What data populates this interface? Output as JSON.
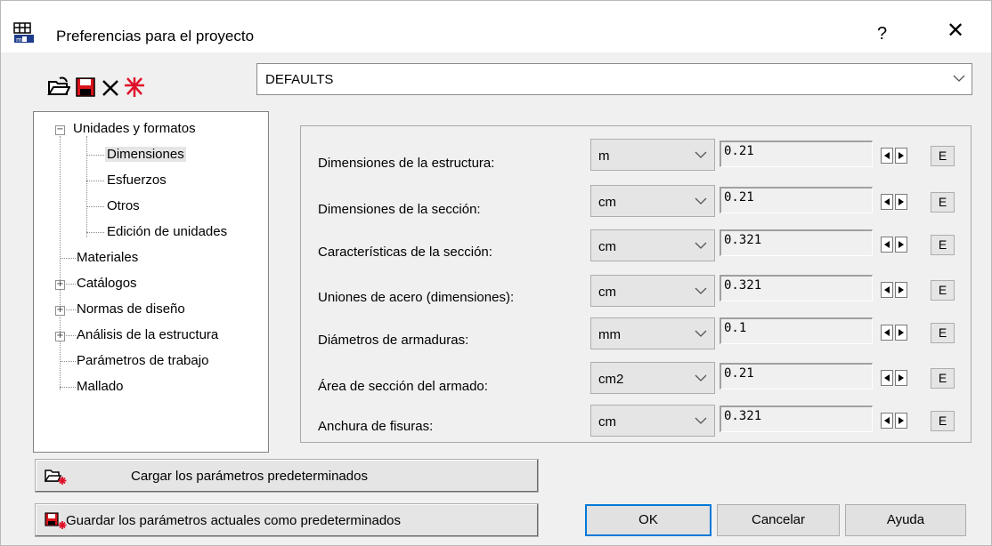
{
  "window": {
    "title": "Preferencias para el proyecto",
    "help": "?",
    "close": "✕"
  },
  "toolbar": {
    "icons": [
      "open-folder-icon",
      "save-disk-icon",
      "delete-x-icon",
      "new-star-icon"
    ]
  },
  "preset_combo": {
    "value": "DEFAULTS"
  },
  "tree": {
    "items": [
      {
        "label": "Unidades y formatos",
        "expander": "−"
      },
      {
        "label": "Dimensiones"
      },
      {
        "label": "Esfuerzos"
      },
      {
        "label": "Otros"
      },
      {
        "label": "Edición de unidades"
      },
      {
        "label": "Materiales"
      },
      {
        "label": "Catálogos",
        "expander": "+"
      },
      {
        "label": "Normas de diseño",
        "expander": "+"
      },
      {
        "label": "Análisis de la estructura",
        "expander": "+"
      },
      {
        "label": "Parámetros de trabajo"
      },
      {
        "label": "Mallado"
      }
    ]
  },
  "rows": [
    {
      "label": "Dimensiones de la estructura:",
      "unit": "m",
      "format": "0.21"
    },
    {
      "label": "Dimensiones de la sección:",
      "unit": "cm",
      "format": "0.21"
    },
    {
      "label": "Características de la sección:",
      "unit": "cm",
      "format": "0.321"
    },
    {
      "label": "Uniones de acero (dimensiones):",
      "unit": "cm",
      "format": "0.321"
    },
    {
      "label": "Diámetros de armaduras:",
      "unit": "mm",
      "format": "0.1"
    },
    {
      "label": "Área de sección del armado:",
      "unit": "cm2",
      "format": "0.21"
    },
    {
      "label": "Anchura de fisuras:",
      "unit": "cm",
      "format": "0.321"
    }
  ],
  "e_label": "E",
  "buttons": {
    "load_defaults": "Cargar los parámetros predeterminados",
    "save_defaults": "Guardar los parámetros actuales como predeterminados",
    "ok": "OK",
    "cancel": "Cancelar",
    "help": "Ayuda"
  }
}
